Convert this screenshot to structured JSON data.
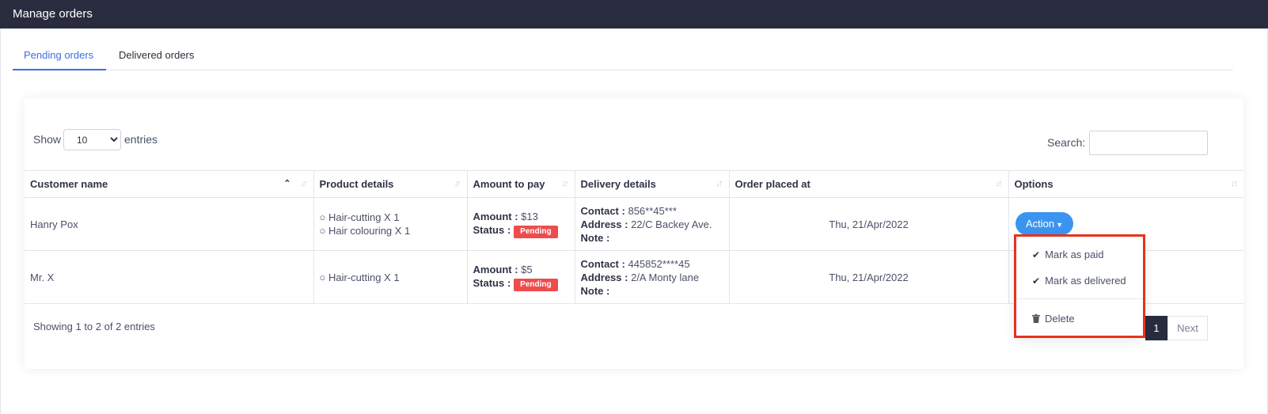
{
  "header": {
    "title": "Manage orders",
    "color": "#292c3e"
  },
  "tabs": [
    {
      "label": "Pending orders",
      "active": true
    },
    {
      "label": "Delivered orders",
      "active": false
    }
  ],
  "controls": {
    "show_label": "Show",
    "entries_value": "10",
    "entries_label": "entries",
    "search_label": "Search:"
  },
  "table": {
    "columns": [
      "Customer name",
      "Product details",
      "Amount to pay",
      "Delivery details",
      "Order placed at",
      "Options"
    ],
    "rows": [
      {
        "customer": "Hanry Pox",
        "products": [
          "○ Hair-cutting X 1",
          "○ Hair colouring X 1"
        ],
        "amount_label": "Amount :",
        "amount": "$13",
        "status_label": "Status :",
        "status": "Pending",
        "contact_label": "Contact :",
        "contact": "856**45***",
        "address_label": "Address :",
        "address": "22/C Backey Ave.",
        "note_label": "Note :",
        "note": "",
        "date": "Thu, 21/Apr/2022"
      },
      {
        "customer": "Mr. X",
        "products": [
          "○ Hair-cutting X 1"
        ],
        "amount_label": "Amount :",
        "amount": "$5",
        "status_label": "Status :",
        "status": "Pending",
        "contact_label": "Contact :",
        "contact": "445852****45",
        "address_label": "Address :",
        "address": "2/A Monty lane",
        "note_label": "Note :",
        "note": "",
        "date": "Thu, 21/Apr/2022"
      }
    ]
  },
  "action_button": {
    "label": "Action"
  },
  "dropdown": {
    "items": [
      {
        "label": "Mark as paid",
        "icon": "check-icon"
      },
      {
        "label": "Mark as delivered",
        "icon": "check-icon"
      },
      {
        "label": "Delete",
        "icon": "trash-icon"
      }
    ]
  },
  "footer": {
    "info": "Showing 1 to 2 of 2 entries",
    "page": "1",
    "next": "Next"
  },
  "colors": {
    "accent": "#3b6fe0",
    "action": "#3b95f0",
    "badge": "#ee4c4c",
    "highlight": "#e8321e"
  }
}
